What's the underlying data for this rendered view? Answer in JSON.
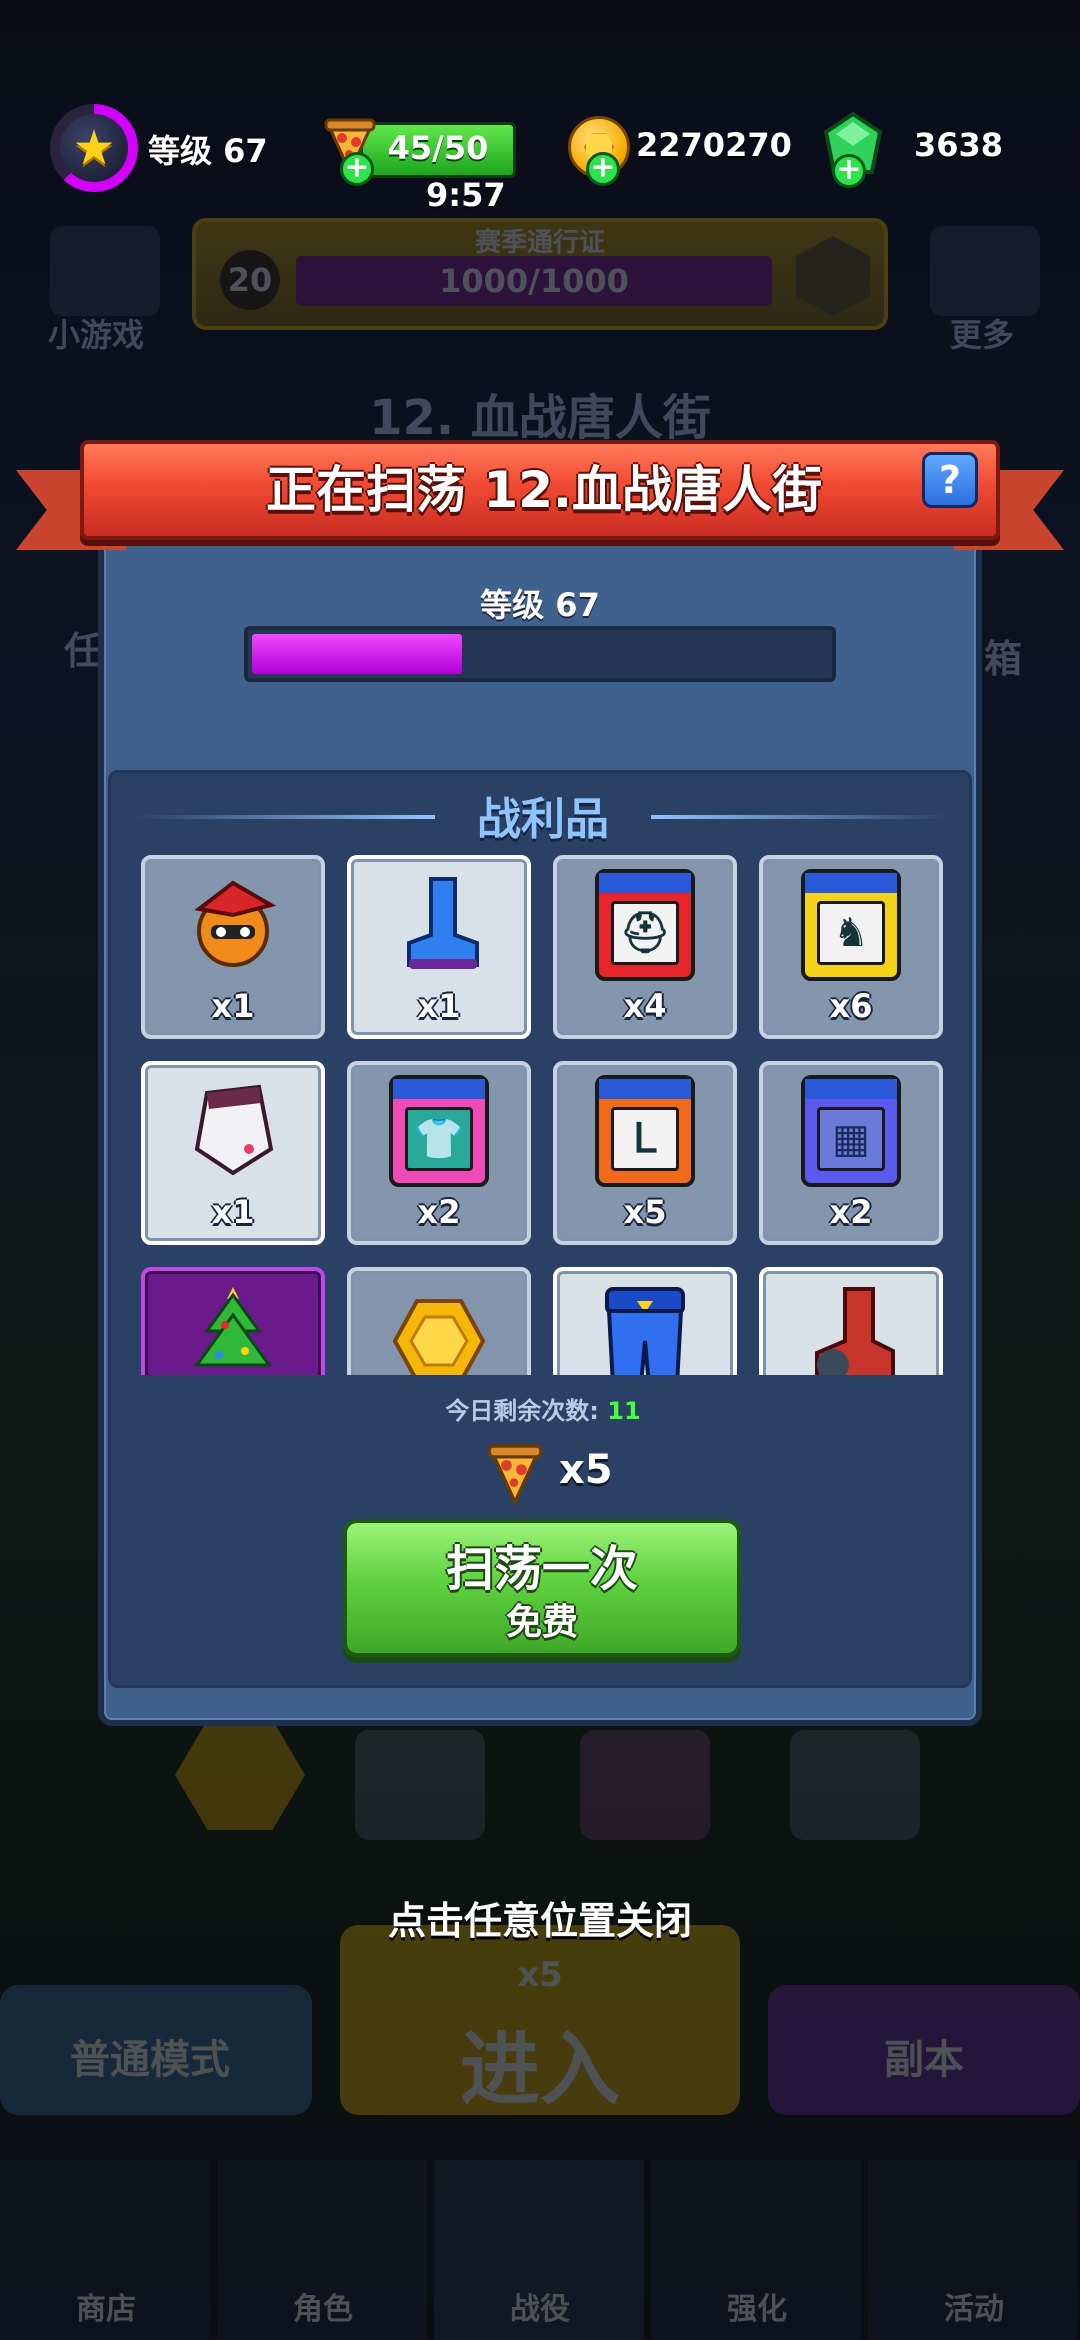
{
  "status_bar": {
    "level_label": "等级 67",
    "level_progress": 0.62,
    "energy": "45/50",
    "energy_timer": "9:57",
    "coins": "2270270",
    "gems": "3638"
  },
  "lobby_background": {
    "season_pass_title": "赛季通行证",
    "season_pass_level": "20",
    "season_pass_progress": "1000/1000",
    "mini_games_label": "小游戏",
    "more_label": "更多",
    "stage_title": "12. 血战唐人街",
    "side_left_label": "任",
    "side_right_label": "箱",
    "normal_mode_label": "普通模式",
    "enter_label": "进入",
    "enter_cost": "x5",
    "dungeon_label": "副本",
    "tabs": [
      "商店",
      "角色",
      "战役",
      "强化",
      "活动"
    ]
  },
  "modal": {
    "title": "正在扫荡 12.血战唐人街",
    "help_label": "?",
    "level_label": "等级 67",
    "level_progress": 0.36,
    "loot_title": "战利品",
    "loot_items": [
      {
        "icon": "hero-mascot-icon",
        "qty": "x1",
        "bg": "gray"
      },
      {
        "icon": "blue-boot-icon",
        "qty": "x1",
        "bg": "white"
      },
      {
        "icon": "red-helmet-card-icon",
        "qty": "x4",
        "bg": "gray"
      },
      {
        "icon": "yellow-helmet-card-icon",
        "qty": "x6",
        "bg": "gray"
      },
      {
        "icon": "white-armor-icon",
        "qty": "x1",
        "bg": "white"
      },
      {
        "icon": "pink-shirt-card-icon",
        "qty": "x2",
        "bg": "gray"
      },
      {
        "icon": "orange-boot-card-icon",
        "qty": "x5",
        "bg": "gray"
      },
      {
        "icon": "blue-vest-card-icon",
        "qty": "x2",
        "bg": "gray"
      },
      {
        "icon": "christmas-tree-icon",
        "qty": "",
        "bg": "purple"
      },
      {
        "icon": "gold-coin-icon",
        "qty": "",
        "bg": "gray"
      },
      {
        "icon": "blue-pants-icon",
        "qty": "",
        "bg": "white"
      },
      {
        "icon": "red-boot-icon",
        "qty": "",
        "bg": "white"
      }
    ],
    "remaining_label": "今日剩余次数:",
    "remaining_count": "11",
    "cost": "x5",
    "sweep_button_line1": "扫荡一次",
    "sweep_button_line2": "免费"
  },
  "close_hint": "点击任意位置关闭",
  "colors": {
    "ribbon": "#f04a33",
    "modal_bg": "#40618e",
    "loot_panel": "#2a4064",
    "xp_fill": "#d400ff",
    "button_green": "#5fd13f",
    "remaining_number": "#46ff3a"
  }
}
